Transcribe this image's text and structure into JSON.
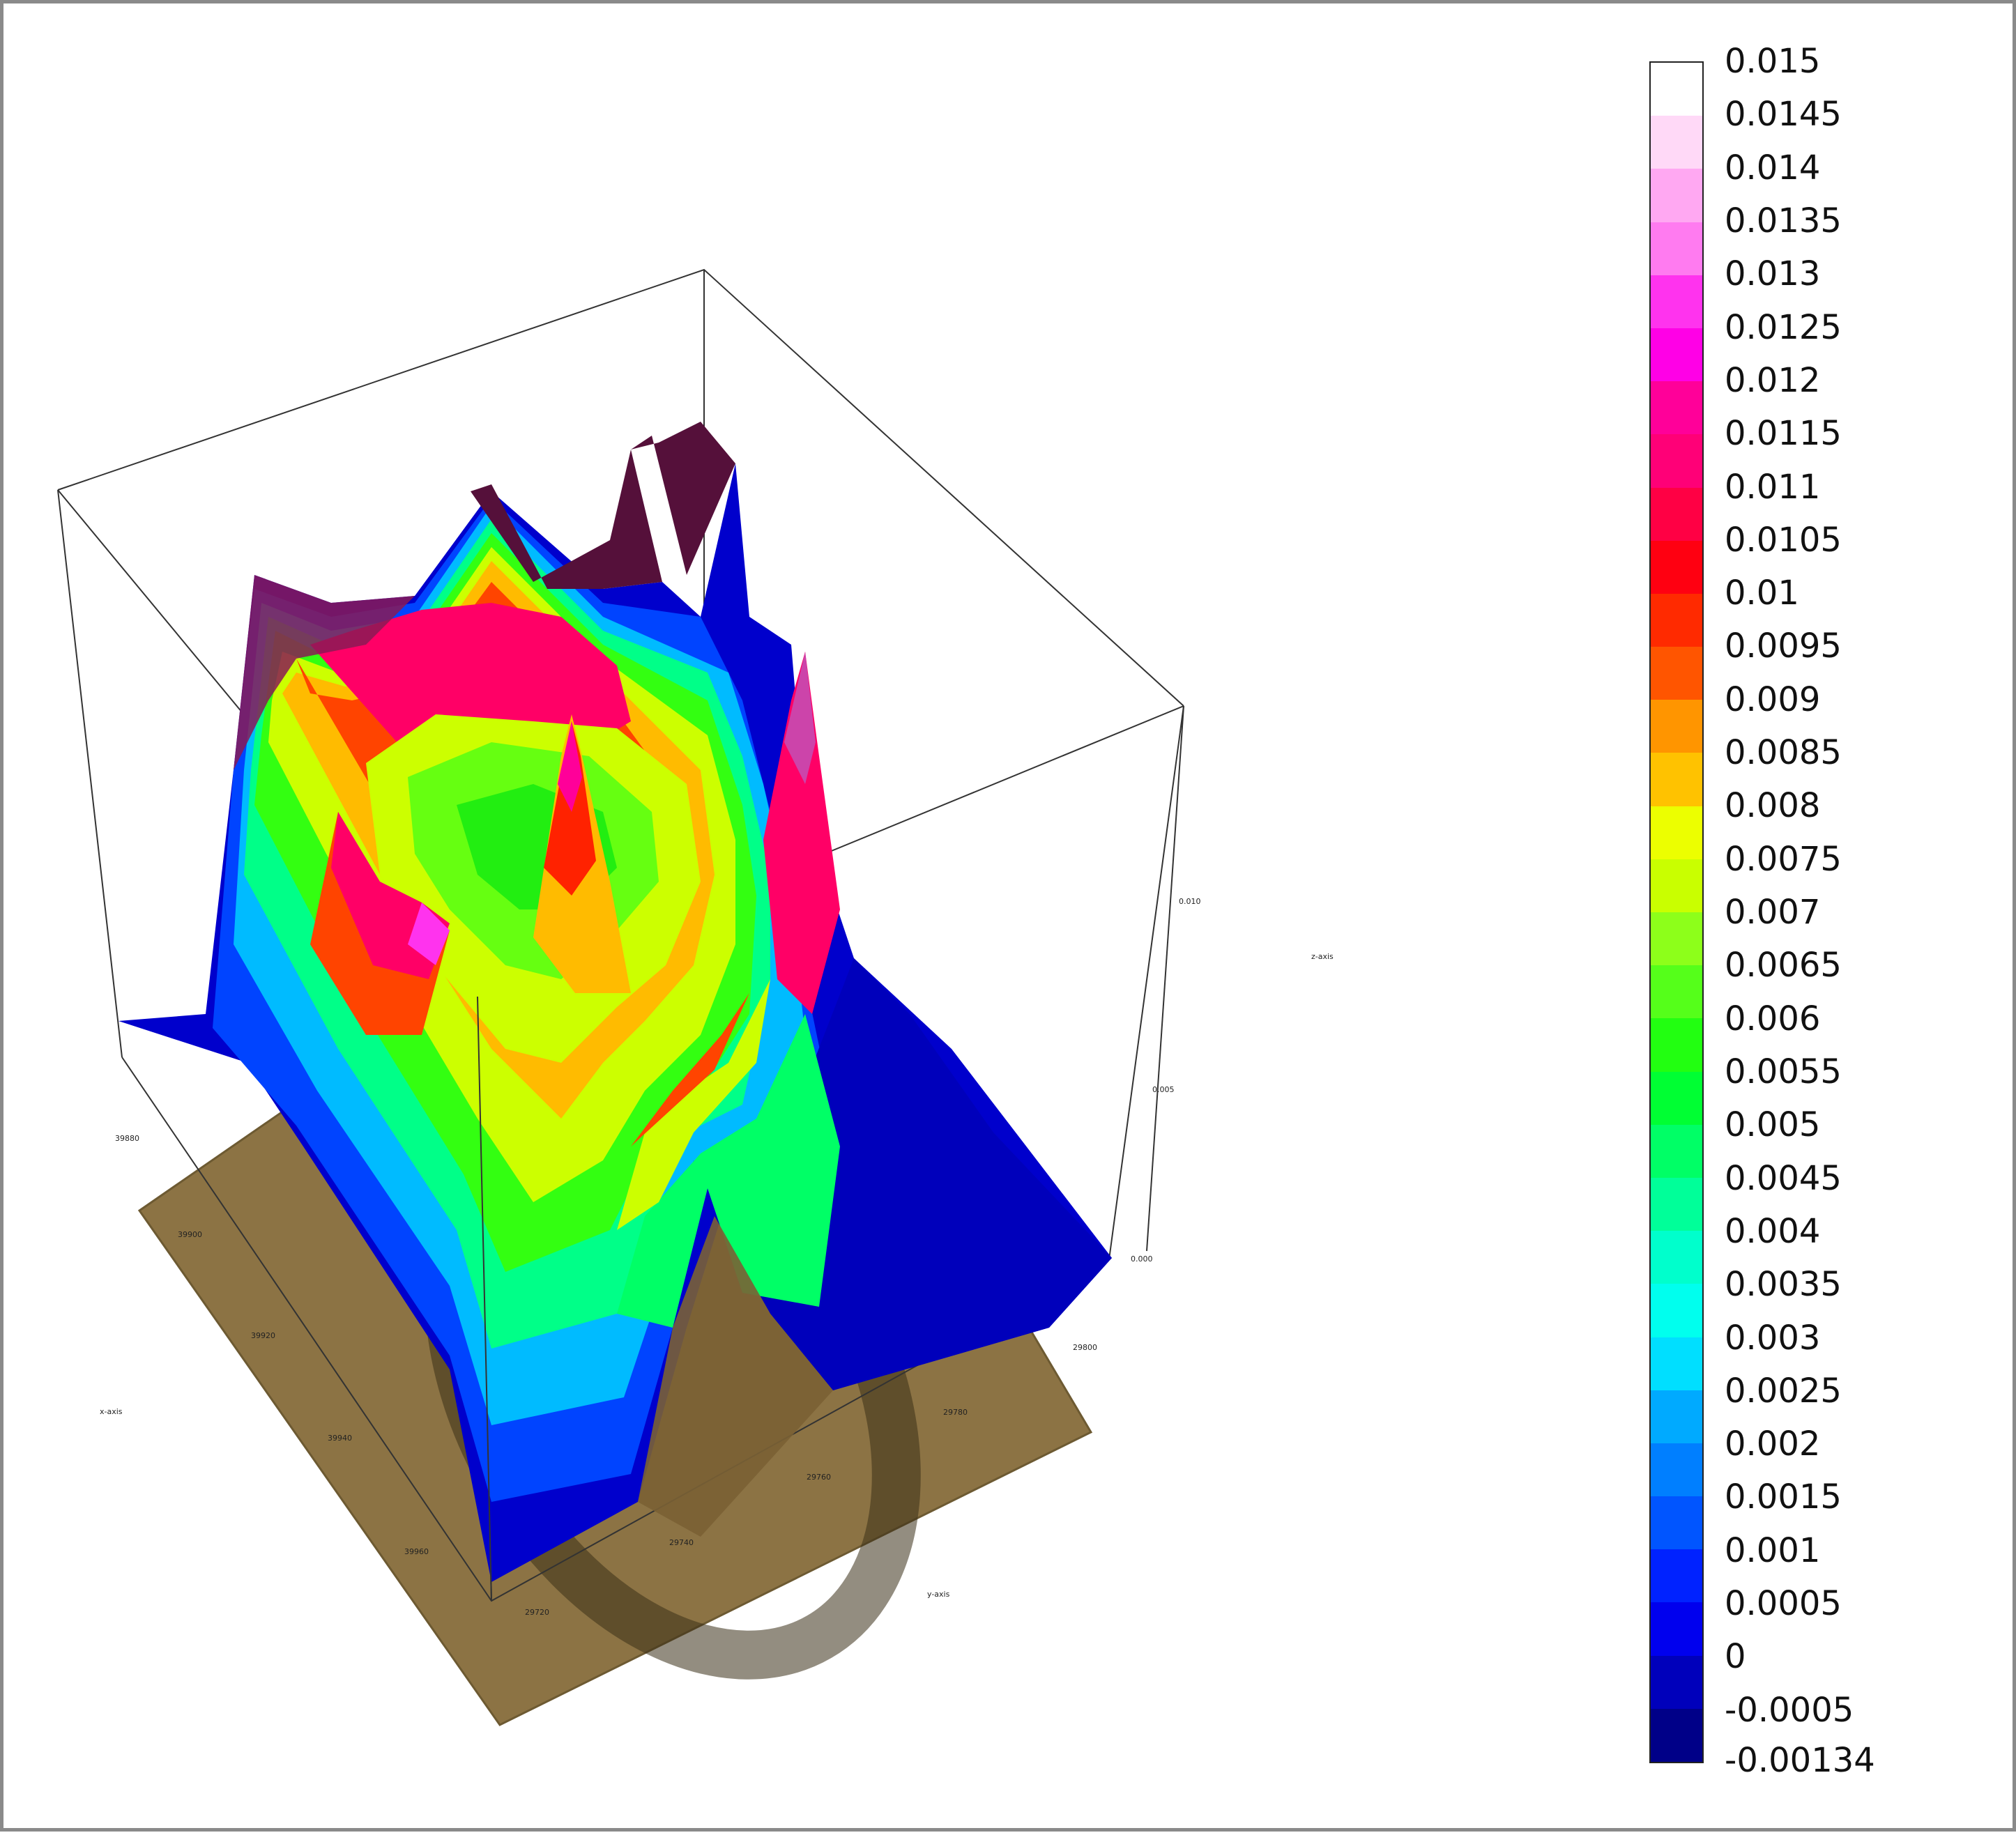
{
  "chart_data": {
    "type": "surface3d",
    "colorbar": {
      "labels": [
        "0.015",
        "0.0145",
        "0.014",
        "0.0135",
        "0.013",
        "0.0125",
        "0.012",
        "0.0115",
        "0.011",
        "0.0105",
        "0.01",
        "0.0095",
        "0.009",
        "0.0085",
        "0.008",
        "0.0075",
        "0.007",
        "0.0065",
        "0.006",
        "0.0055",
        "0.005",
        "0.0045",
        "0.004",
        "0.0035",
        "0.003",
        "0.0025",
        "0.002",
        "0.0015",
        "0.001",
        "0.0005",
        "0",
        "-0.0005",
        "-0.00134"
      ],
      "colors": [
        "#ffffff",
        "#ffd9f7",
        "#ffa8f2",
        "#ff7bf0",
        "#ff33ee",
        "#ff00e6",
        "#ff0099",
        "#ff0077",
        "#ff0044",
        "#ff0011",
        "#ff2a00",
        "#ff5500",
        "#ff9500",
        "#ffc200",
        "#ecff00",
        "#c9ff00",
        "#8dff1a",
        "#55ff1a",
        "#22ff11",
        "#00ff33",
        "#00ff66",
        "#00ff99",
        "#00ffcc",
        "#00ffee",
        "#00dfff",
        "#00aaff",
        "#007fff",
        "#0055ff",
        "#0022ff",
        "#0000ee",
        "#0000bb",
        "#000088"
      ],
      "min": -0.00134,
      "max": 0.015
    },
    "axes": {
      "x": {
        "label": "x-axis",
        "ticks": [
          "39880",
          "39900",
          "39920",
          "39940",
          "39960"
        ]
      },
      "y": {
        "label": "y-axis",
        "ticks": [
          "29720",
          "29740",
          "29760",
          "29780",
          "29800"
        ]
      },
      "z": {
        "label": "z-axis",
        "ticks": [
          "0.000",
          "0.005",
          "0.010"
        ]
      }
    }
  }
}
